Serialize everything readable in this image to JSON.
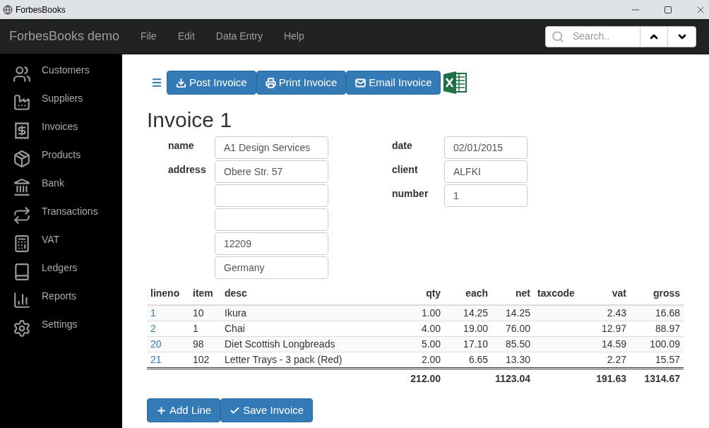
{
  "window": {
    "title": "ForbesBooks"
  },
  "navbar": {
    "brand": "ForbesBooks demo",
    "menu": [
      "File",
      "Edit",
      "Data Entry",
      "Help"
    ],
    "search": {
      "placeholder": "Search.."
    }
  },
  "sidebar": {
    "items": [
      {
        "label": "Customers",
        "kind": "users"
      },
      {
        "label": "Suppliers",
        "kind": "factory"
      },
      {
        "label": "Invoices",
        "kind": "receipt"
      },
      {
        "label": "Products",
        "kind": "box"
      },
      {
        "label": "Bank",
        "kind": "bank"
      },
      {
        "label": "Transactions",
        "kind": "repeat"
      },
      {
        "label": "VAT",
        "kind": "calculator"
      },
      {
        "label": "Ledgers",
        "kind": "book"
      },
      {
        "label": "Reports",
        "kind": "chart"
      },
      {
        "label": "Settings",
        "kind": "gear"
      }
    ]
  },
  "toolbar": {
    "buttons": [
      {
        "label": "Post Invoice",
        "kind": "post"
      },
      {
        "label": "Print Invoice",
        "kind": "print"
      },
      {
        "label": "Email Invoice",
        "kind": "email"
      }
    ]
  },
  "title": "Invoice 1",
  "form": {
    "left": [
      {
        "label": "name",
        "kind": "single",
        "values": [
          {
            "value": "A1 Design Services"
          }
        ]
      },
      {
        "label": "address",
        "kind": "address",
        "values": [
          {
            "value": "Obere Str. 57"
          },
          {
            "value": "12209"
          },
          {
            "value": "Germany"
          }
        ]
      }
    ],
    "right": [
      {
        "label": "date",
        "value": "02/01/2015"
      },
      {
        "label": "client",
        "value": "ALFKI"
      },
      {
        "label": "number",
        "value": "1"
      }
    ]
  },
  "table": {
    "columns": [
      "lineno",
      "item",
      "desc",
      "qty",
      "each",
      "net",
      "taxcode",
      "vat",
      "gross"
    ],
    "rows": [
      [
        "1",
        "10",
        "Ikura",
        "1.00",
        "14.25",
        "14.25",
        null,
        "2.43",
        "16.68"
      ],
      [
        "2",
        "1",
        "Chai",
        "4.00",
        "19.00",
        "76.00",
        null,
        "12.97",
        "88.97"
      ],
      [
        "20",
        "98",
        "Diet Scottish Longbreads",
        "5.00",
        "17.10",
        "85.50",
        null,
        "14.59",
        "100.09"
      ],
      [
        "21",
        "102",
        "Letter Trays - 3 pack (Red)",
        "2.00",
        "6.65",
        "13.30",
        null,
        "2.27",
        "15.57"
      ]
    ],
    "totals": {
      "qty": "212.00",
      "net": "1123.04",
      "vat": "191.63",
      "gross": "1314.67"
    }
  },
  "actions": [
    {
      "label": "Add Line",
      "kind": "add"
    },
    {
      "label": "Save Invoice",
      "kind": "save"
    }
  ]
}
